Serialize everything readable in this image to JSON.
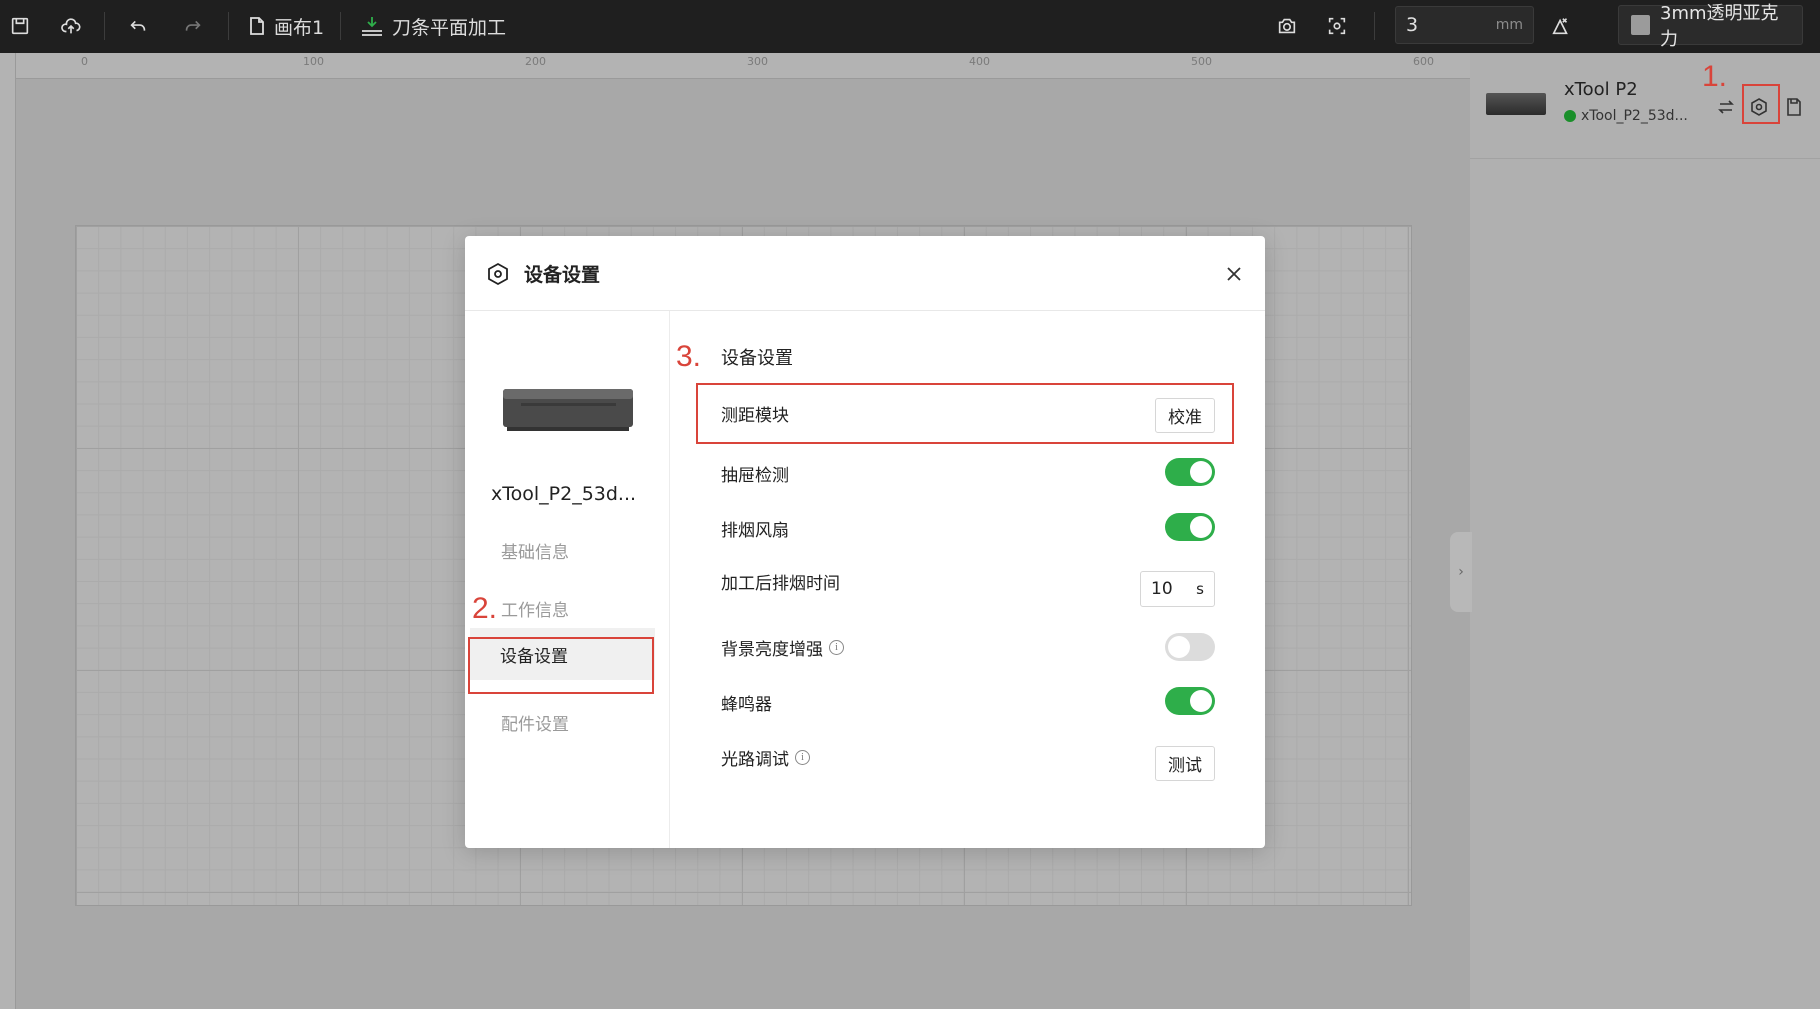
{
  "toolbar": {
    "canvas_name": "画布1",
    "mode_label": "刀条平面加工",
    "thickness_value": "3",
    "thickness_unit": "mm",
    "material_label": "3mm透明亚克力"
  },
  "ruler": {
    "top_labels": [
      "0",
      "100",
      "200",
      "300",
      "400",
      "500",
      "600"
    ]
  },
  "device_panel": {
    "name": "xTool P2",
    "status_text": "xTool_P2_53d...",
    "status_color": "#1a8f2a"
  },
  "annotations": {
    "step1": "1.",
    "step2": "2.",
    "step3": "3.",
    "color": "#d9443a"
  },
  "modal": {
    "title": "设备设置",
    "side": {
      "device_name": "xTool_P2_53d...",
      "items": [
        {
          "label": "基础信息"
        },
        {
          "label": "工作信息"
        },
        {
          "label": "设备设置",
          "active": true
        },
        {
          "label": "配件设置"
        }
      ]
    },
    "content": {
      "section_title": "设备设置",
      "rows": {
        "distance_module": {
          "label": "测距模块",
          "button": "校准"
        },
        "drawer_detect": {
          "label": "抽屉检测",
          "enabled": true
        },
        "exhaust_fan": {
          "label": "排烟风扇",
          "enabled": true
        },
        "post_exhaust_time": {
          "label": "加工后排烟时间",
          "value": "10",
          "unit": "s"
        },
        "background_brightness": {
          "label": "背景亮度增强",
          "enabled": false
        },
        "buzzer": {
          "label": "蜂鸣器",
          "enabled": true
        },
        "optical_debug": {
          "label": "光路调试",
          "button": "测试"
        }
      }
    }
  },
  "colors": {
    "toggle_on": "#2eae4a",
    "toggle_off": "#dcdcdc",
    "toolbar_bg": "#1f1f1f"
  }
}
